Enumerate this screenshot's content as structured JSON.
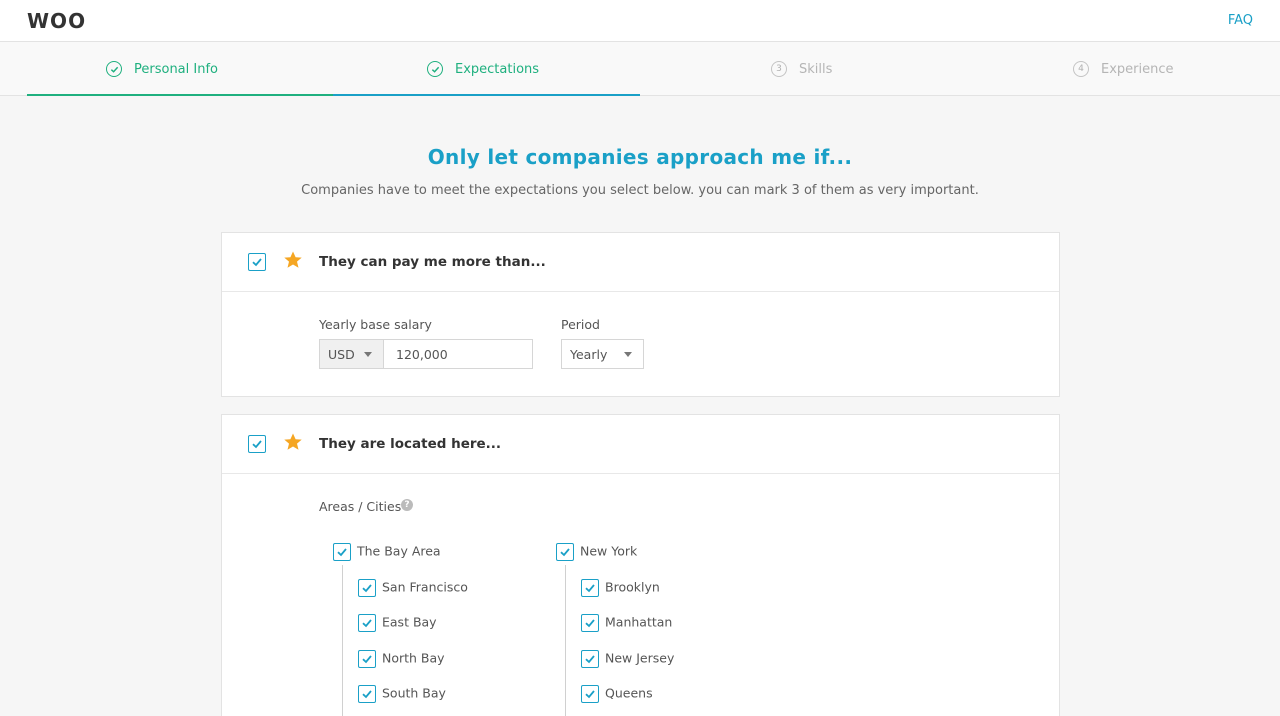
{
  "header": {
    "logo": "WOO",
    "faq_label": "FAQ"
  },
  "steps": [
    {
      "label": "Personal Info",
      "status": "done"
    },
    {
      "label": "Expectations",
      "status": "done"
    },
    {
      "label": "Skills",
      "status": "todo",
      "number": "3"
    },
    {
      "label": "Experience",
      "status": "todo",
      "number": "4"
    }
  ],
  "intro": {
    "title": "Only let companies approach me if...",
    "subtitle": "Companies have to meet the expectations you select below. you can mark 3 of them as very important."
  },
  "salary_card": {
    "checked": true,
    "starred": true,
    "title": "They can pay me more than...",
    "salary_label": "Yearly base salary",
    "currency": "USD",
    "amount": "120,000",
    "period_label": "Period",
    "period": "Yearly"
  },
  "location_card": {
    "checked": true,
    "starred": true,
    "title": "They are located here...",
    "areas_label": "Areas / Cities",
    "groups": [
      {
        "name": "The Bay Area",
        "items": [
          "San Francisco",
          "East Bay",
          "North Bay",
          "South Bay"
        ]
      },
      {
        "name": "New York",
        "items": [
          "Brooklyn",
          "Manhattan",
          "New Jersey",
          "Queens"
        ]
      }
    ]
  },
  "colors": {
    "accent": "#1aa0c7",
    "success": "#1fb07f",
    "star": "#f5a623"
  },
  "icons": {
    "step_done": "check-circle-icon",
    "checkbox": "checkmark-icon",
    "star": "star-icon",
    "help": "question-circle-icon",
    "dropdown": "caret-down-icon"
  }
}
